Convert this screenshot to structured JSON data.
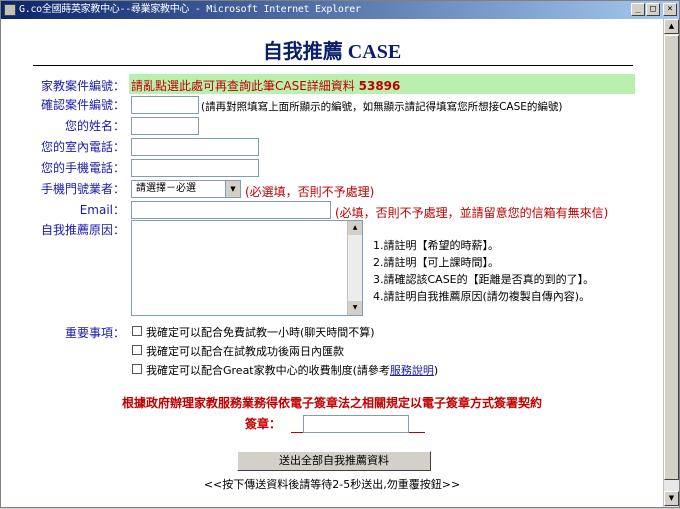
{
  "window": {
    "title": "G.co全國蒔英家教中心--尋業家教中心 - Microsoft Internet Explorer",
    "buttons": [
      "_",
      "□",
      "×"
    ]
  },
  "form": {
    "heading": "自我推薦 CASE",
    "case_no_label": "家教案件編號：",
    "case_no_text": "請亂點選此處可再查詢此筆CASE詳細資料",
    "case_no_value": "53896",
    "confirm_label": "確認案件編號：",
    "confirm_note": "(請再對照填寫上面所顯示的編號，如無顯示請記得填寫您所想接CASE的編號)",
    "name_label": "您的姓名：",
    "home_phone_label": "您的室內電話：",
    "mobile_label": "您的手機電話：",
    "carrier_label": "手機門號業者：",
    "carrier_select": "請選擇－必選",
    "carrier_note": "(必選填，否則不予處理)",
    "email_label": "Email：",
    "email_note": "(必填，否則不予處理，並請留意您的信箱有無來信)",
    "reason_label": "自我推薦原因：",
    "reason_tips": [
      "1.請註明【希望的時薪】。",
      "2.請註明【可上課時間】。",
      "3.請確認該CASE的【距離是否真的到的了】。",
      "4.請註明自我推薦原因(請勿複製自傳內容)。"
    ],
    "important_label": "重要事項：",
    "checks": [
      "我確定可以配合免費試教一小時(聊天時間不算)",
      "我確定可以配合在試教成功後兩日內匯款",
      "我確定可以配合Great家教中心的收費制度(請參考"
    ],
    "fee_link": "服務說明",
    "fee_close": ")",
    "law_note": "根據政府辦理家教服務業務得依電子簽章法之相關規定以電子簽章方式簽署契約",
    "sign_label": "簽章：",
    "submit_label": "送出全部自我推薦資料",
    "submit_hint": "<<按下傳送資料後請等待2-5秒送出,勿重覆按鈕>>"
  },
  "colors": {
    "label": "#1a1aa8",
    "note": "#c00000",
    "highlight": "#b9f0b0"
  }
}
